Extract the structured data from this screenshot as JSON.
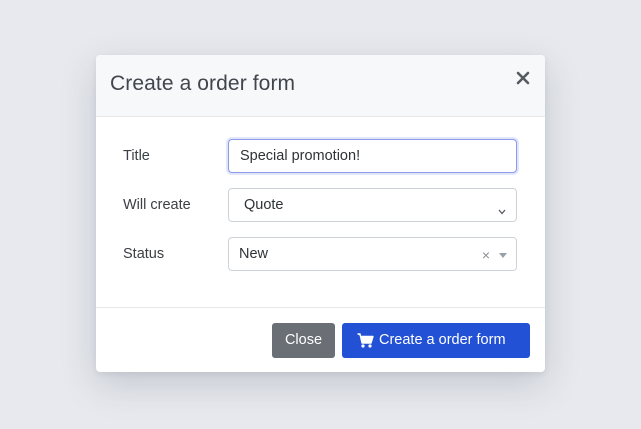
{
  "modal": {
    "title": "Create a order form",
    "close_icon": "close-icon"
  },
  "form": {
    "title_label": "Title",
    "title_value": "Special promotion!",
    "will_create_label": "Will create",
    "will_create_value": "Quote",
    "status_label": "Status",
    "status_value": "New",
    "status_clear": "×"
  },
  "footer": {
    "close_label": "Close",
    "create_label": "Create a order form",
    "create_icon": "shopping-cart-icon"
  },
  "colors": {
    "primary": "#2251d6",
    "secondary": "#6a6e75",
    "focus_border": "#8d9ae6"
  }
}
